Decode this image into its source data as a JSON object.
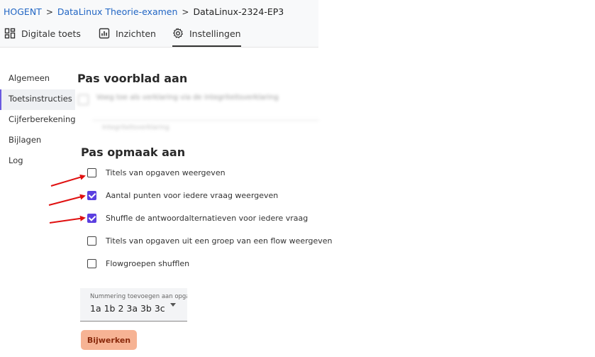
{
  "breadcrumb": {
    "items": [
      "HOGENT",
      "DataLinux Theorie-examen",
      "DataLinux-2324-EP3"
    ],
    "separator": ">"
  },
  "tabs": [
    {
      "label": "Digitale toets",
      "icon": "dashboard-icon"
    },
    {
      "label": "Inzichten",
      "icon": "bar-chart-icon"
    },
    {
      "label": "Instellingen",
      "icon": "gear-icon",
      "active": true
    }
  ],
  "sidebar": {
    "items": [
      {
        "label": "Algemeen"
      },
      {
        "label": "Toetsinstructies",
        "active": true
      },
      {
        "label": "Cijferberekening"
      },
      {
        "label": "Bijlagen"
      },
      {
        "label": "Log"
      }
    ]
  },
  "cover": {
    "heading": "Pas voorblad aan",
    "blurred_option": "Voeg toe als verklaring via de integriteitsverklaring",
    "blurred_field": "Integriteitsverklaring"
  },
  "format": {
    "heading": "Pas opmaak aan",
    "options": [
      {
        "label": "Titels van opgaven weergeven",
        "checked": false
      },
      {
        "label": "Aantal punten voor iedere vraag weergeven",
        "checked": true
      },
      {
        "label": "Shuffle de antwoordalternatieven voor iedere vraag",
        "checked": true
      },
      {
        "label": "Titels van opgaven uit een groep van een flow weergeven",
        "checked": false
      },
      {
        "label": "Flowgroepen shufflen",
        "checked": false
      }
    ]
  },
  "numbering": {
    "label": "Nummering toevoegen aan opgaven",
    "value": "1a 1b 2 3a 3b 3c"
  },
  "update_button": "Bijwerken",
  "colors": {
    "accent": "#5b3fe0",
    "link": "#2266c4",
    "button_bg": "#f6b394",
    "button_text": "#8a2a0c",
    "annotation_arrow": "#e01010"
  }
}
